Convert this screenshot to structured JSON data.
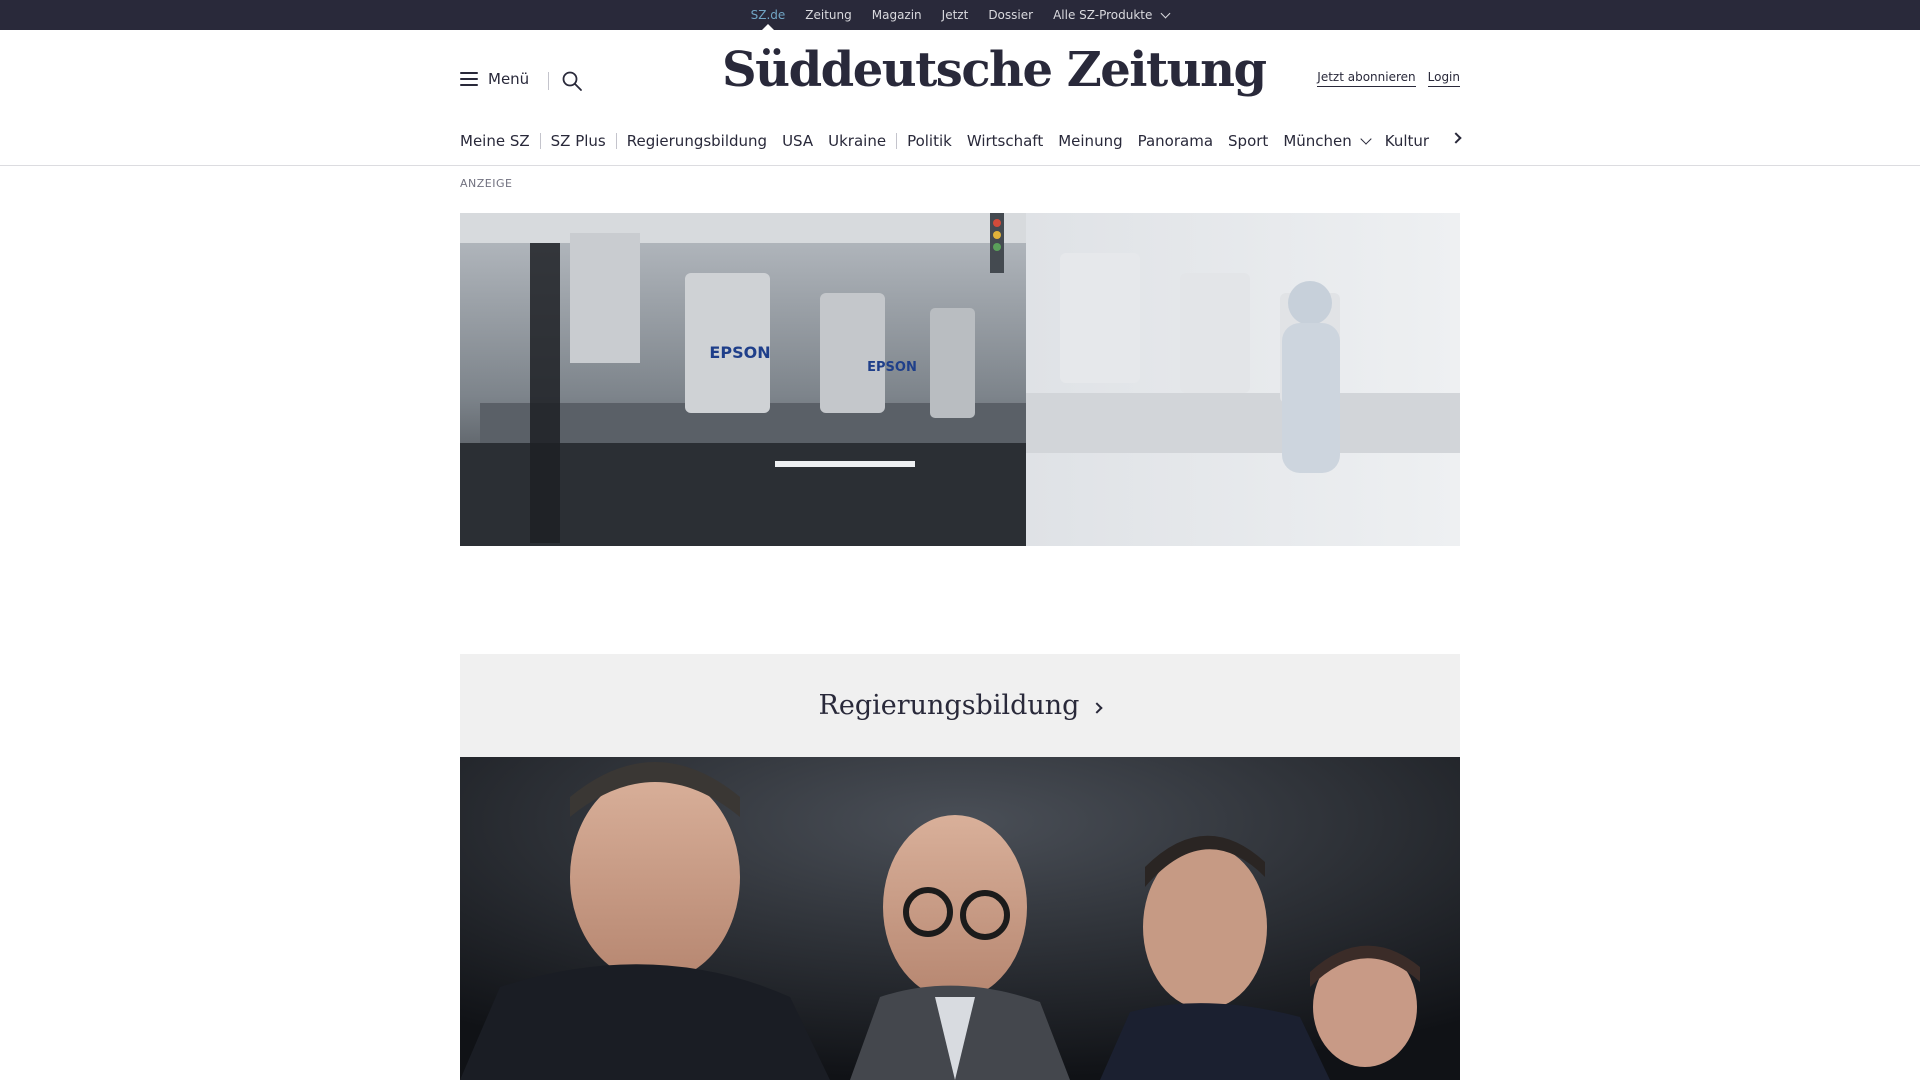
{
  "topbar": {
    "items": [
      "SZ.de",
      "Zeitung",
      "Magazin",
      "Jetzt",
      "Dossier",
      "Alle SZ-Produkte"
    ],
    "active": "SZ.de"
  },
  "header": {
    "menu_label": "Menü",
    "logo": "Süddeutsche Zeitung",
    "subscribe_label": "Jetzt abonnieren",
    "login_label": "Login"
  },
  "nav": {
    "items": [
      "Meine SZ",
      "SZ Plus",
      "Regierungsbildung",
      "USA",
      "Ukraine",
      "Politik",
      "Wirtschaft",
      "Meinung",
      "Panorama",
      "Sport",
      "München",
      "Kultur"
    ]
  },
  "ad": {
    "label": "ANZEIGE",
    "brand_text": "EPSON"
  },
  "section": {
    "title": "Regierungsbildung"
  },
  "colors": {
    "topbar_bg": "#29293a",
    "accent": "#71a5c4",
    "text": "#29293a",
    "section_bg": "#f0f0f0"
  },
  "icons": {
    "menu": "hamburger-icon",
    "search": "search-icon",
    "nav_more": "chevron-right-icon"
  }
}
